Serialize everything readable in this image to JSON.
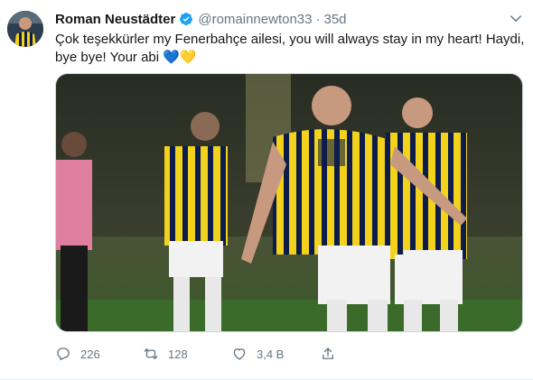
{
  "tweet": {
    "name": "Roman Neustädter",
    "handle": "@romainnewton33",
    "separator": "·",
    "time": "35d",
    "text": "Çok teşekkürler my Fenerbahçe ailesi, you will always stay in my heart! Haydi, bye bye! Your abi 💙💛",
    "media_alt": "Fenerbahçe players celebrating on the pitch"
  },
  "actions": {
    "reply_count": "226",
    "retweet_count": "128",
    "like_count": "3,4 B"
  },
  "colors": {
    "verified": "#1da1f2",
    "muted": "#657786",
    "jersey_navy": "#0d1c4a",
    "jersey_yellow": "#f2d21b"
  }
}
